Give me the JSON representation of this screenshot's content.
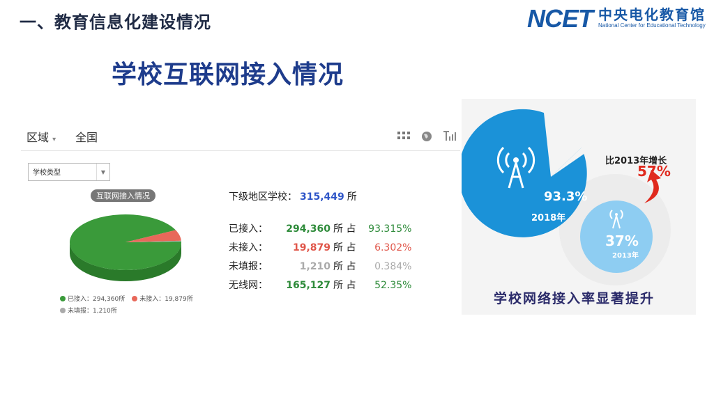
{
  "header": {
    "section_title": "一、教育信息化建设情况",
    "logo_mark": "NCET",
    "logo_cn": "中央电化教育馆",
    "logo_en": "National Center for Educational Technology"
  },
  "main_title": "学校互联网接入情况",
  "panel": {
    "region_label": "区域",
    "region_value": "全国",
    "toolbar": {
      "grid_icon": "grid-icon",
      "globe_icon": "globe-icon",
      "signal_icon": "signal-bars-icon"
    },
    "school_type_select": {
      "value": "学校类型"
    },
    "pie_title": "互联网接入情况",
    "pie": {
      "type": "pie",
      "slices": [
        {
          "label": "已接入",
          "value": 294360
        },
        {
          "label": "未接入",
          "value": 19879
        },
        {
          "label": "未填报",
          "value": 1210
        }
      ],
      "colors": [
        "#3a9a3a",
        "#e8685a",
        "#aaaaaa"
      ]
    },
    "legend": [
      {
        "text": "已接入：294,360所",
        "color": "#3a9a3a"
      },
      {
        "text": "未接入：19,879所",
        "color": "#e8685a"
      },
      {
        "text": "未填报：1,210所",
        "color": "#aaaaaa"
      }
    ],
    "total": {
      "label": "下级地区学校：",
      "value": "315,449",
      "unit": "所"
    },
    "stats": [
      {
        "label": "已接入：",
        "value": "294,360",
        "unit": "所 占",
        "pct": "93.315%",
        "color": "#2e8b3a",
        "pct_color": "#2e8b3a"
      },
      {
        "label": "未接入：",
        "value": "19,879",
        "unit": "所 占",
        "pct": "6.302%",
        "color": "#e0564a",
        "pct_color": "#e0564a"
      },
      {
        "label": "未填报：",
        "value": "1,210",
        "unit": "所 占",
        "pct": "0.384%",
        "color": "#aaaaaa",
        "pct_color": "#aaaaaa"
      },
      {
        "label": "无线网：",
        "value": "165,127",
        "unit": "所 占",
        "pct": "52.35%",
        "color": "#2e8b3a",
        "pct_color": "#2e8b3a"
      }
    ]
  },
  "infographic": {
    "growth_label": "比2013年增长",
    "growth_value": "57%",
    "big_value": "93.3%",
    "big_year": "2018年",
    "small_value": "37%",
    "small_year": "2013年",
    "caption": "学校网络接入率显著提升",
    "antenna_icon": "antenna-icon",
    "arrow_icon": "up-arrow-icon",
    "colors": {
      "blue": "#1b92d8",
      "light_blue": "#8ecdf2",
      "red": "#e02a1e"
    }
  }
}
